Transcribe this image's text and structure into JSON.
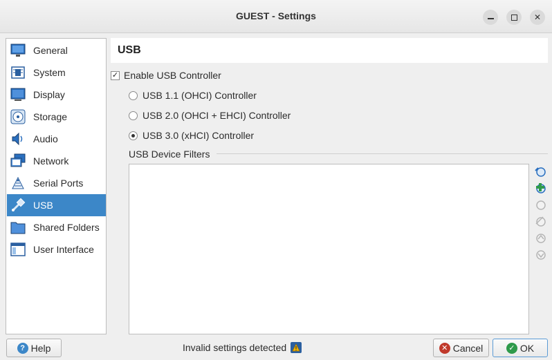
{
  "window": {
    "title": "GUEST - Settings"
  },
  "sidebar": {
    "items": [
      {
        "label": "General",
        "icon": "general-icon"
      },
      {
        "label": "System",
        "icon": "system-icon"
      },
      {
        "label": "Display",
        "icon": "display-icon"
      },
      {
        "label": "Storage",
        "icon": "storage-icon"
      },
      {
        "label": "Audio",
        "icon": "audio-icon"
      },
      {
        "label": "Network",
        "icon": "network-icon"
      },
      {
        "label": "Serial Ports",
        "icon": "serial-ports-icon"
      },
      {
        "label": "USB",
        "icon": "usb-icon",
        "selected": true
      },
      {
        "label": "Shared Folders",
        "icon": "shared-folders-icon"
      },
      {
        "label": "User Interface",
        "icon": "user-interface-icon"
      }
    ]
  },
  "usb": {
    "header": "USB",
    "enable_label": "Enable USB Controller",
    "enable_checked": true,
    "controllers": [
      {
        "label": "USB 1.1 (OHCI) Controller",
        "selected": false
      },
      {
        "label": "USB 2.0 (OHCI + EHCI) Controller",
        "selected": false
      },
      {
        "label": "USB 3.0 (xHCI) Controller",
        "selected": true
      }
    ],
    "filters_label": "USB Device Filters",
    "filter_tools": [
      "add-filter-icon",
      "add-from-device-icon",
      "edit-filter-icon",
      "remove-filter-icon",
      "move-up-icon",
      "move-down-icon"
    ]
  },
  "footer": {
    "help_label": "Help",
    "status_text": "Invalid settings detected",
    "cancel_label": "Cancel",
    "ok_label": "OK"
  },
  "colors": {
    "accent": "#3c87c8",
    "ok_green": "#2e9a4b",
    "cancel_red": "#c0392b"
  }
}
